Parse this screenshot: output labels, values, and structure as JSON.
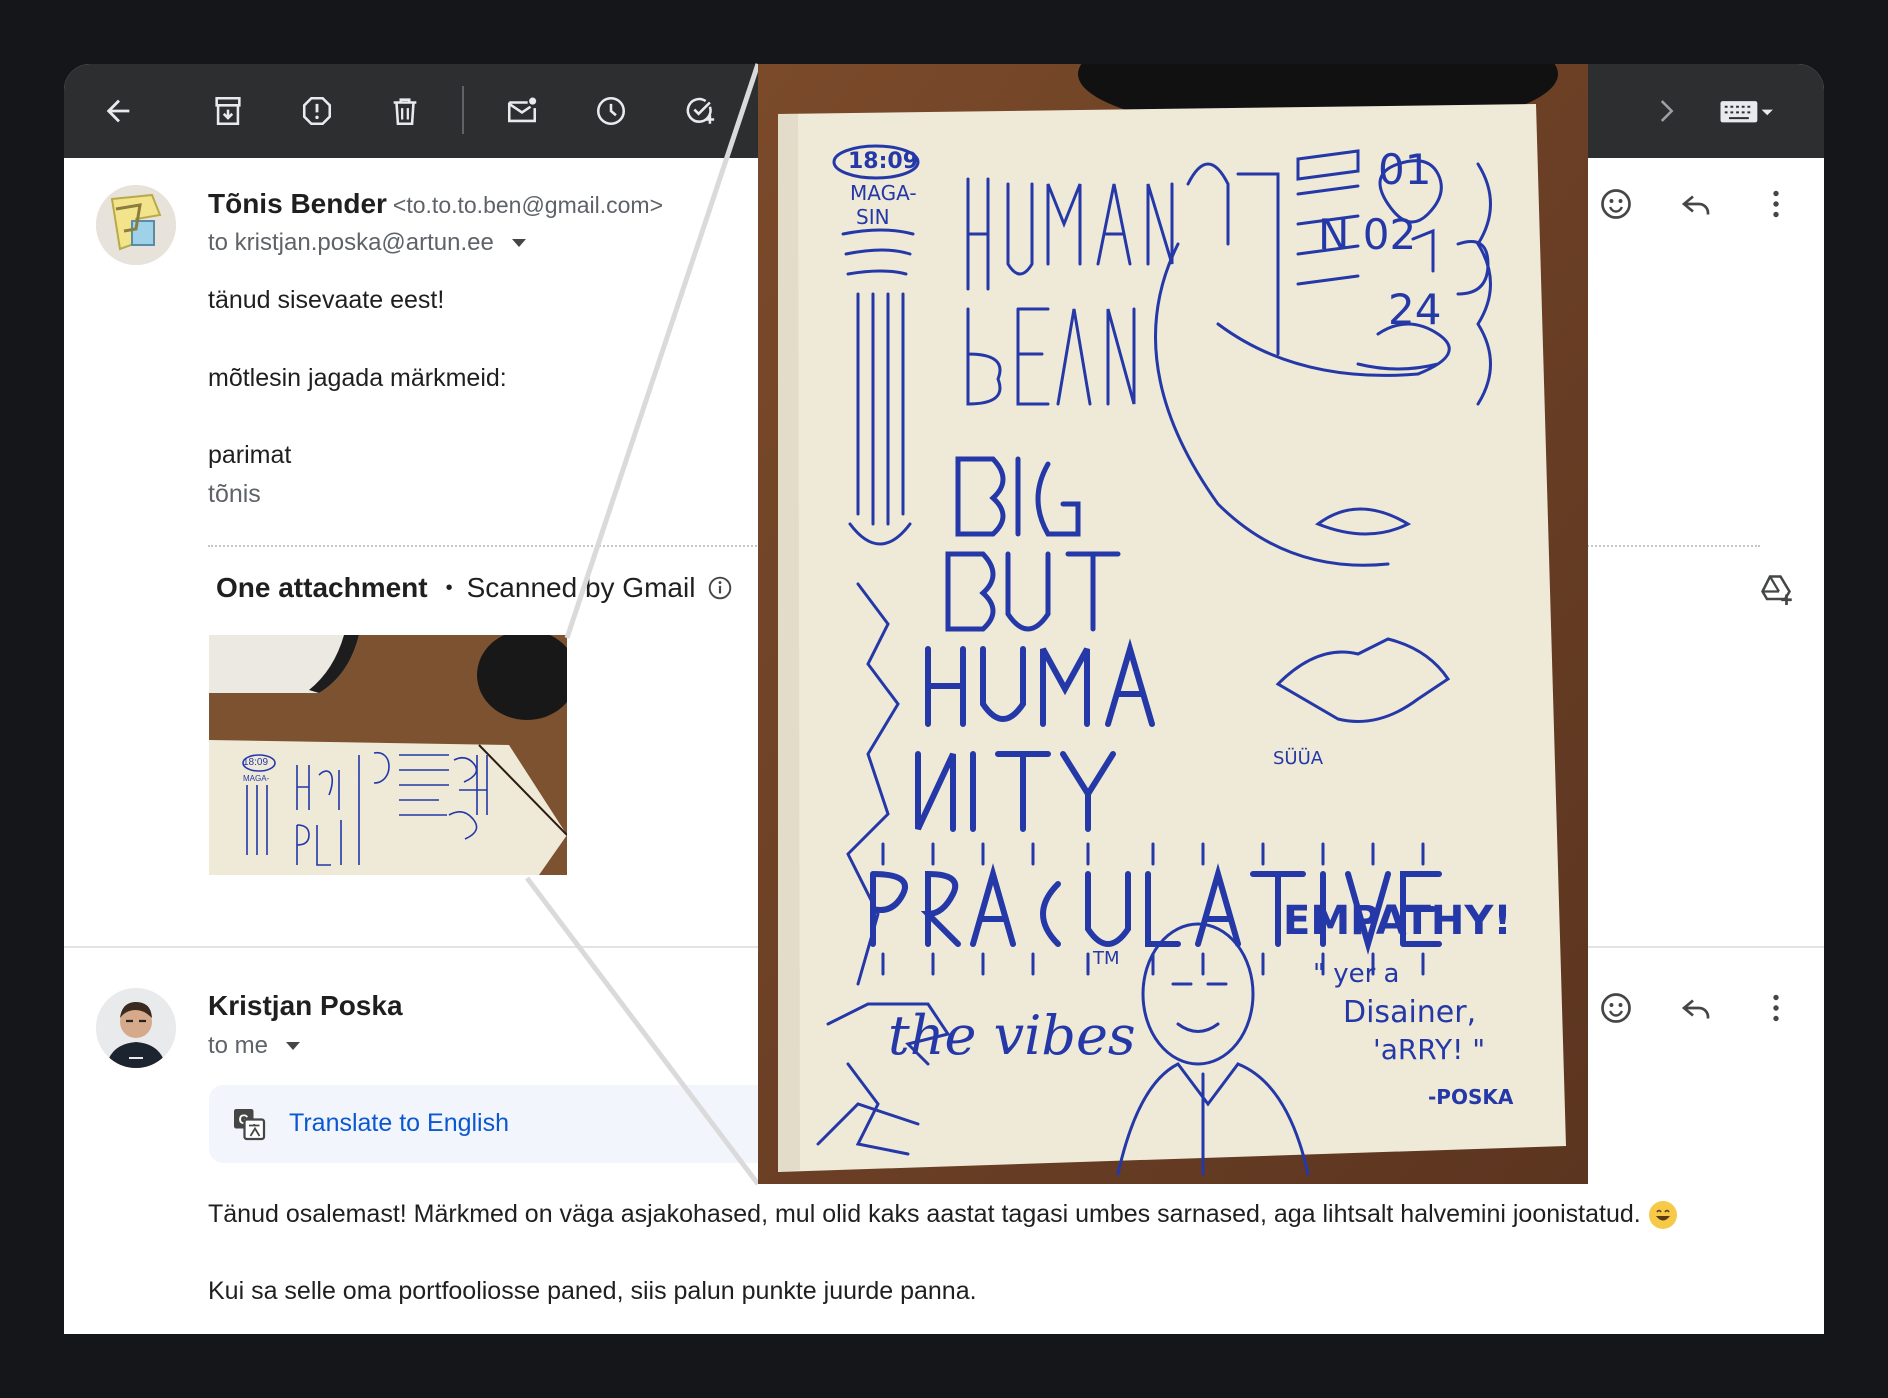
{
  "toolbar": {
    "icons": [
      "back-arrow-icon",
      "archive-icon",
      "report-spam-icon",
      "delete-icon",
      "mark-unread-icon",
      "snooze-icon",
      "add-task-icon",
      "chevron-right-icon",
      "keyboard-icon"
    ]
  },
  "message1": {
    "sender_name": "Tõnis Bender",
    "sender_email": "<to.to.to.ben@gmail.com>",
    "recipient": "to kristjan.poska@artun.ee",
    "body": [
      "tänud sisevaate eest!",
      "mõtlesin jagada märkmeid:",
      "parimat"
    ],
    "signature": "tõnis"
  },
  "attachments": {
    "title": "One attachment",
    "separator": "•",
    "scanned": "Scanned by Gmail"
  },
  "message2": {
    "sender_name": "Kristjan Poska",
    "recipient": "to me",
    "translate": "Translate to English",
    "body": [
      "Tänud osalemast! Märkmed on väga asjakohased, mul olid kaks aastat tagasi umbes sarnased, aga lihtsalt halvemini joonistatud.",
      "Kui sa selle oma portfooliosse paned, siis palun punkte juurde panna."
    ]
  },
  "sketch": {
    "texts": [
      "18:09",
      "MAGA-",
      "SIN",
      "HUMAN",
      "BEAN",
      "BIG",
      "BUT",
      "HUMA",
      "NITY",
      "PRACULATIVE",
      "01",
      "N 02",
      "24",
      "SÜÜA",
      "the vibes",
      "TM",
      "EMPATHY!",
      "\" yer a",
      "Disainer,",
      "'aRRY! \"",
      "-POSKA"
    ]
  },
  "colors": {
    "toolbar_bg": "#2d2e30",
    "link": "#0b57d0",
    "ink": "#2438a8",
    "paper": "#efe9d8"
  }
}
